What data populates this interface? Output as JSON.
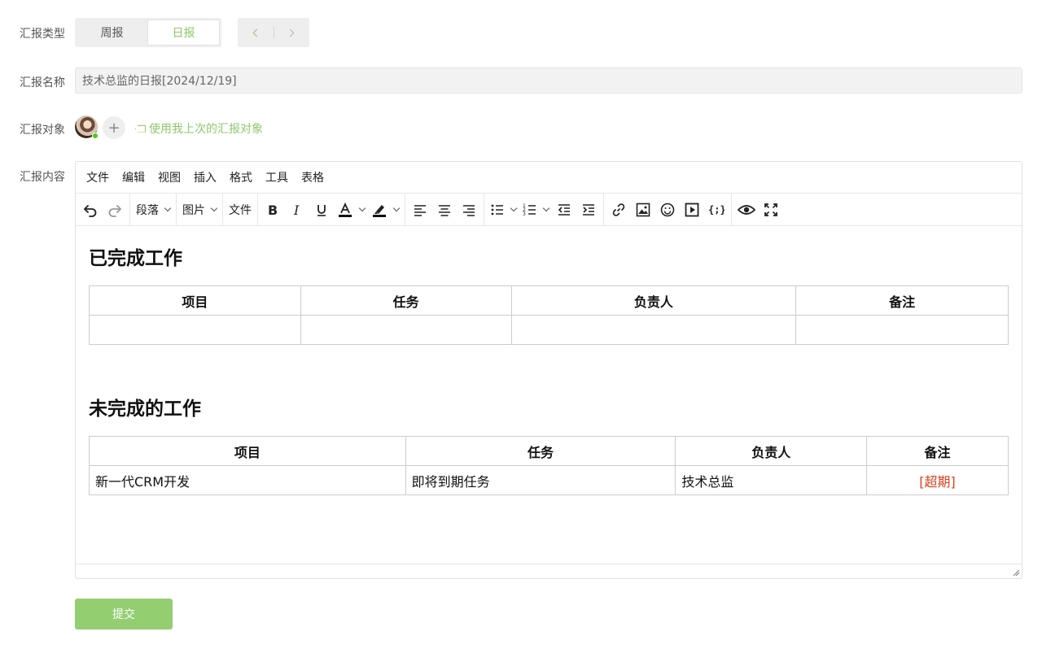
{
  "form": {
    "type_label": "汇报类型",
    "name_label": "汇报名称",
    "target_label": "汇报对象",
    "content_label": "汇报内容"
  },
  "report_type": {
    "options": [
      "周报",
      "日报"
    ],
    "selected": "日报"
  },
  "report_name": {
    "value": "技术总监的日报[2024/12/19]"
  },
  "targets": {
    "reuse_link": "使用我上次的汇报对象"
  },
  "editor": {
    "menu": [
      "文件",
      "编辑",
      "视图",
      "插入",
      "格式",
      "工具",
      "表格"
    ],
    "toolbar": {
      "paragraph": "段落",
      "image": "图片",
      "file": "文件"
    },
    "icons": [
      "undo-icon",
      "redo-icon",
      "bold-icon",
      "italic-icon",
      "underline-icon",
      "text-color-icon",
      "highlight-icon",
      "align-left-icon",
      "align-center-icon",
      "align-right-icon",
      "bullet-list-icon",
      "numbered-list-icon",
      "outdent-icon",
      "indent-icon",
      "link-icon",
      "image-icon",
      "emoji-icon",
      "media-icon",
      "code-icon",
      "preview-icon",
      "fullscreen-icon"
    ],
    "sections": [
      {
        "heading": "已完成工作",
        "columns": [
          "项目",
          "任务",
          "负责人",
          "备注"
        ],
        "rows": [
          [
            "",
            "",
            "",
            ""
          ]
        ]
      },
      {
        "heading": "未完成的工作",
        "columns": [
          "项目",
          "任务",
          "负责人",
          "备注"
        ],
        "rows": [
          [
            "新一代CRM开发",
            "即将到期任务",
            "技术总监",
            "[超期]"
          ]
        ]
      }
    ]
  },
  "actions": {
    "submit": "提交"
  },
  "colors": {
    "accent": "#8cc96a",
    "submit_bg": "#93cf71",
    "overdue": "#e23e1c",
    "online": "#52c41a"
  }
}
